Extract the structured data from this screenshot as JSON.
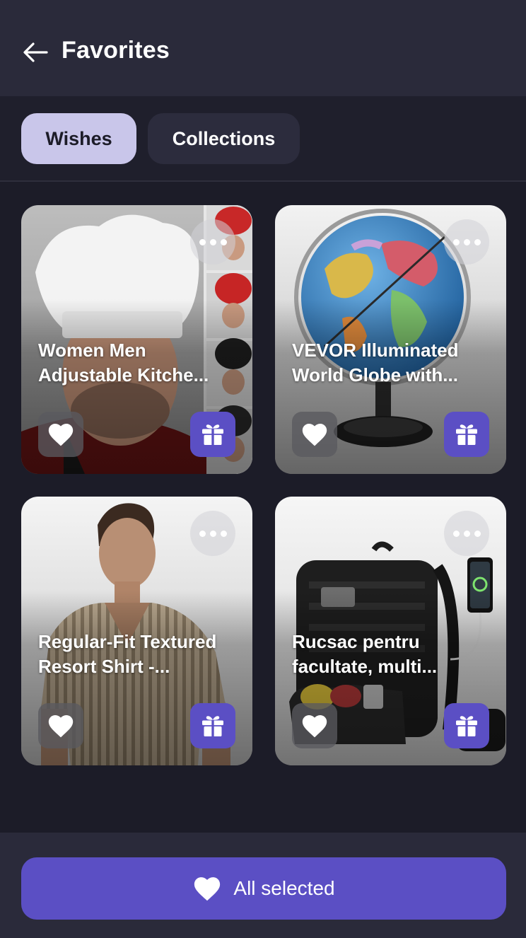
{
  "header": {
    "title": "Favorites",
    "back_icon": "arrow-left-icon"
  },
  "tabs": [
    {
      "label": "Wishes",
      "active": true
    },
    {
      "label": "Collections",
      "active": false
    }
  ],
  "wishes": [
    {
      "title": "Women Men\nAdjustable Kitche...",
      "image": "chef-hat-photo"
    },
    {
      "title": "VEVOR Illuminated\nWorld Globe with...",
      "image": "globe-photo"
    },
    {
      "title": "Regular-Fit Textured\nResort Shirt -...",
      "image": "shirt-photo"
    },
    {
      "title": "Rucsac pentru\nfacultate, multi...",
      "image": "backpack-photo"
    }
  ],
  "footer": {
    "button_label": "All selected",
    "button_icon": "heart-icon"
  },
  "colors": {
    "accent": "#5b4fc4",
    "active_tab": "#c9c6ea",
    "background": "#1c1c28",
    "header_bg": "#2a2a3a"
  }
}
